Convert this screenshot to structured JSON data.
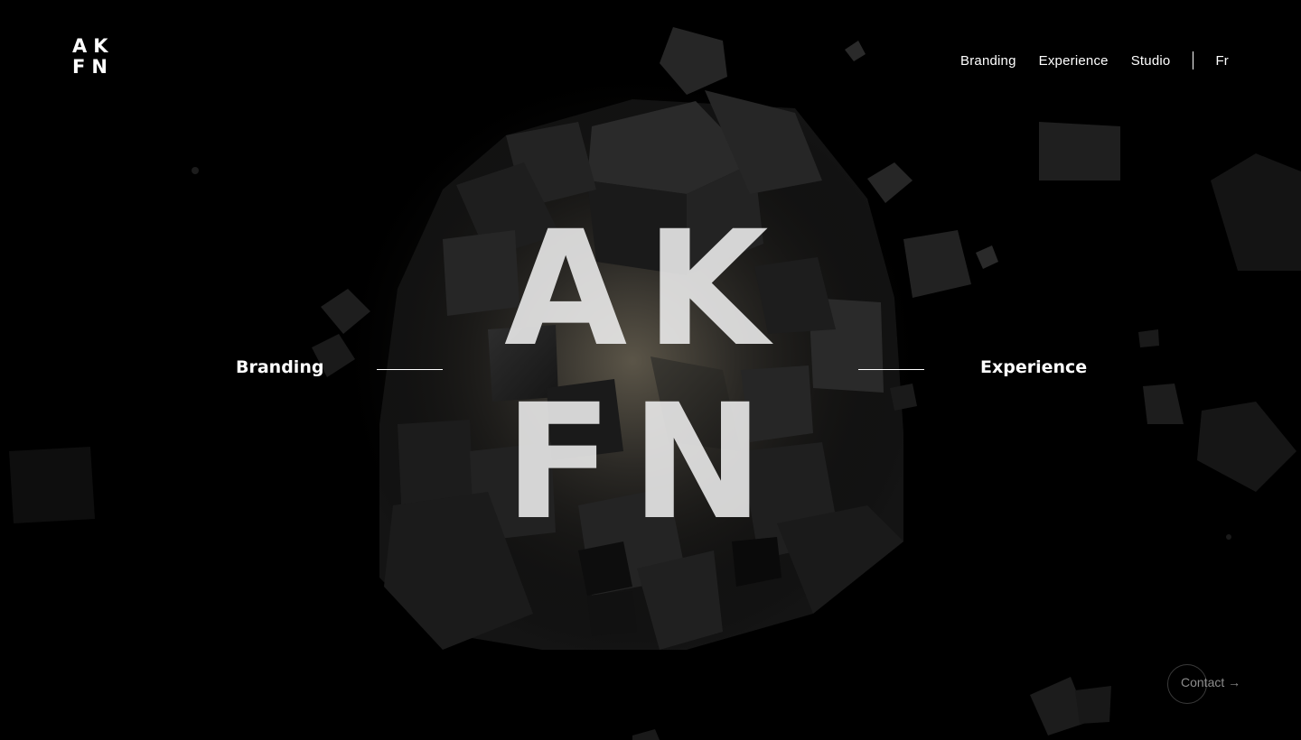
{
  "logo": {
    "line1": "AK",
    "line2": "FN"
  },
  "nav": {
    "items": [
      {
        "label": "Branding"
      },
      {
        "label": "Experience"
      },
      {
        "label": "Studio"
      }
    ],
    "language": "Fr"
  },
  "hero": {
    "line1": "AK",
    "line2": "FN",
    "left_link": "Branding",
    "right_link": "Experience"
  },
  "contact": {
    "label": "Contact →"
  },
  "colors": {
    "background": "#000000",
    "text": "#ffffff",
    "cube": "#1f1f1f"
  },
  "icons": [
    "arrow-right-icon"
  ]
}
